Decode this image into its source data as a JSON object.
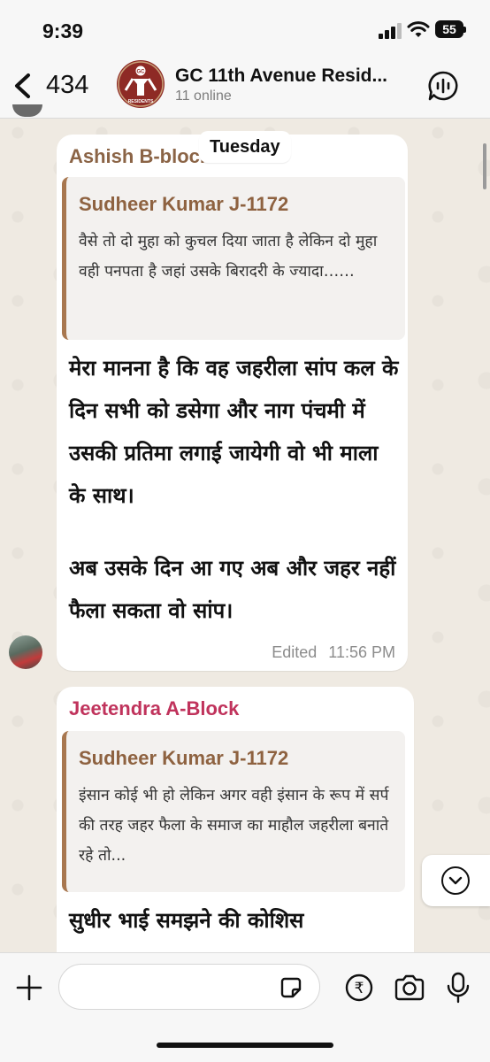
{
  "status_bar": {
    "time": "9:39",
    "battery": "55",
    "signal-icon": "cellular-signal-icon",
    "wifi-icon": "wifi-icon"
  },
  "header": {
    "back_count": "434",
    "group_name": "GC 11th Avenue Resid...",
    "online": "11 online",
    "avatar_text": "GC",
    "avatar_subtext": "RESIDENTS",
    "avatar_color": "#8e2a25"
  },
  "day_separator": "Tuesday",
  "messages": [
    {
      "sender": "Ashish B-block",
      "sender_color": "#8b6446",
      "quote": {
        "author": "Sudheer Kumar J-1172",
        "text": "वैसे तो दो मुहा को कुचल दिया जाता है लेकिन दो मुहा वही पनपता है जहां उसके बिरादरी के ज्यादा……"
      },
      "paragraph_1": "मेरा मानना है कि वह जहरीला सांप कल के दिन सभी को डसेगा और नाग पंचमी में उसकी प्रतिमा लगाई जायेगी वो भी माला के साथ।",
      "paragraph_2": "अब उसके दिन आ गए अब और जहर नहीं फैला सकता वो सांप।",
      "edited": "Edited",
      "time": "11:56 PM"
    },
    {
      "sender": "Jeetendra A-Block",
      "sender_color": "#c0335c",
      "quote": {
        "author": "Sudheer Kumar J-1172",
        "text": "इंसान कोई भी हो लेकिन अगर वही इंसान के रूप में सर्प की तरह जहर फैला के समाज का माहौल जहरीला बनाते रहे तो..."
      },
      "text": "सुधीर भाई समझने की कोशिस"
    }
  ],
  "input": {
    "placeholder": "",
    "value": ""
  },
  "colors": {
    "quote_bar": "#a8774f",
    "quote_author": "#8e6240",
    "wallpaper": "#efeae2"
  }
}
